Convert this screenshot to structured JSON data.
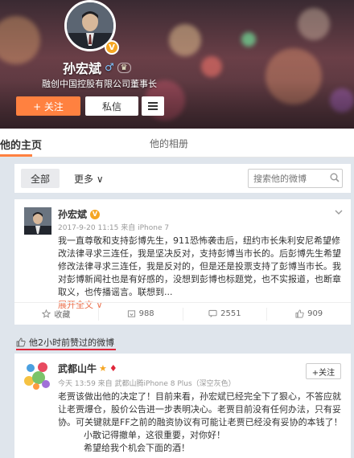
{
  "profile": {
    "name": "孙宏斌",
    "rank_badge": "♛",
    "verified_mark": "V",
    "description": "融创中国控股有限公司董事长",
    "follow_label": "+ 关注",
    "message_label": "私信"
  },
  "tabs": {
    "home": "他的主页",
    "album": "他的相册"
  },
  "filter": {
    "all_label": "全部",
    "more_label": "更多 ∨",
    "search_placeholder": "搜索他的微博"
  },
  "post1": {
    "author": "孙宏斌",
    "meta": "2017-9-20 11:15 来自 iPhone 7",
    "body": "我一直尊敬和支持彭博先生，911恐怖袭击后，纽约市长朱利安尼希望修改法律寻求三连任，我是坚决反对，支持彭博当市长的。后彭博先生希望修改法律寻求三连任，我是反对的，但是还是投票支持了彭博当市长。我对彭博新闻社也是有好感的，没想到彭博也标题党，也不实报道，也断章取义，也传播谣言。联想到...",
    "expand": "展开全文 ∨",
    "actions": {
      "favorite": "收藏",
      "repost": "988",
      "comment": "2551",
      "like": "909"
    }
  },
  "liked_label": "他2小时前赞过的微博",
  "post2": {
    "author": "武都山牛",
    "meta": "今天 13:59 来自 武都山腾iPhone 8 Plus（深空灰色）",
    "follow_label": "+关注",
    "body_main": "老贾该做出他的决定了！目前来看，孙宏斌已经完全下了狠心，不答应就让老贾爆仓，股价公告进一步表明决心。老贾目前没有任何办法，只有妥协。可关键就是FF之前的融资协议有可能让老贾已经没有妥协的本钱了！",
    "body_line2": "小散记得撤单，这很重要，对你好！",
    "body_line3": "希望给我个机会下面的酒！"
  },
  "colors": {
    "accent_orange": "#ff8140",
    "link_orange": "#eb7350",
    "liked_red": "#e0263a",
    "verified_gold": "#f5a623"
  }
}
